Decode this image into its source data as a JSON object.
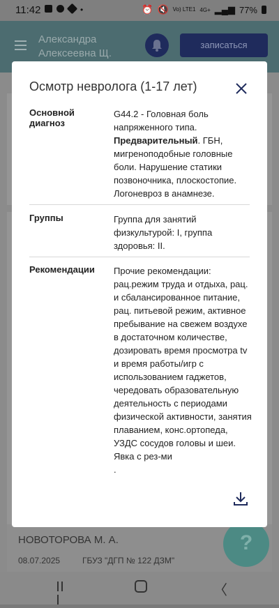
{
  "status": {
    "time": "11:42",
    "battery": "77%",
    "network": "4G+",
    "carrier": "Vo) LTE1"
  },
  "header": {
    "user_line1": "Александра",
    "user_line2": "Алексеевна Щ.",
    "signup_label": "записаться"
  },
  "modal": {
    "title": "Осмотр невролога (1-17 лет)",
    "sections": [
      {
        "label": "Основной диагноз",
        "value_code": "G44.2 - Головная боль напряженного типа.",
        "value_bold": "Предварительный",
        "value_rest": ". ГБН, мигреноподобные головные боли. Нарушение статики позвоночника, плоскостопие. Логоневроз в анамнезе."
      },
      {
        "label": "Группы",
        "value": "Группа для занятий физкультурой: I, группа здоровья: II."
      },
      {
        "label": "Рекомендации",
        "value": "Прочие рекомендации: рац.режим труда и отдыха, рац. и сбалансированное питание, рац. питьевой режим, активное пребывание на свежем воздухе в достаточном количестве, дозировать время просмотра tv  и  время работы/игр с использованием гаджетов, чередовать образовательную деятельность с периодами физической активности, занятия плаванием, конс.ортопеда, УЗДС сосудов головы и шеи. Явка с рез-ми\n."
      }
    ]
  },
  "background_card": {
    "doctor": "НОВОТОРОВА М. А.",
    "date": "08.07.2025",
    "clinic": "ГБУЗ \"ДГП № 122 ДЗМ\""
  },
  "help": {
    "label": "?"
  }
}
